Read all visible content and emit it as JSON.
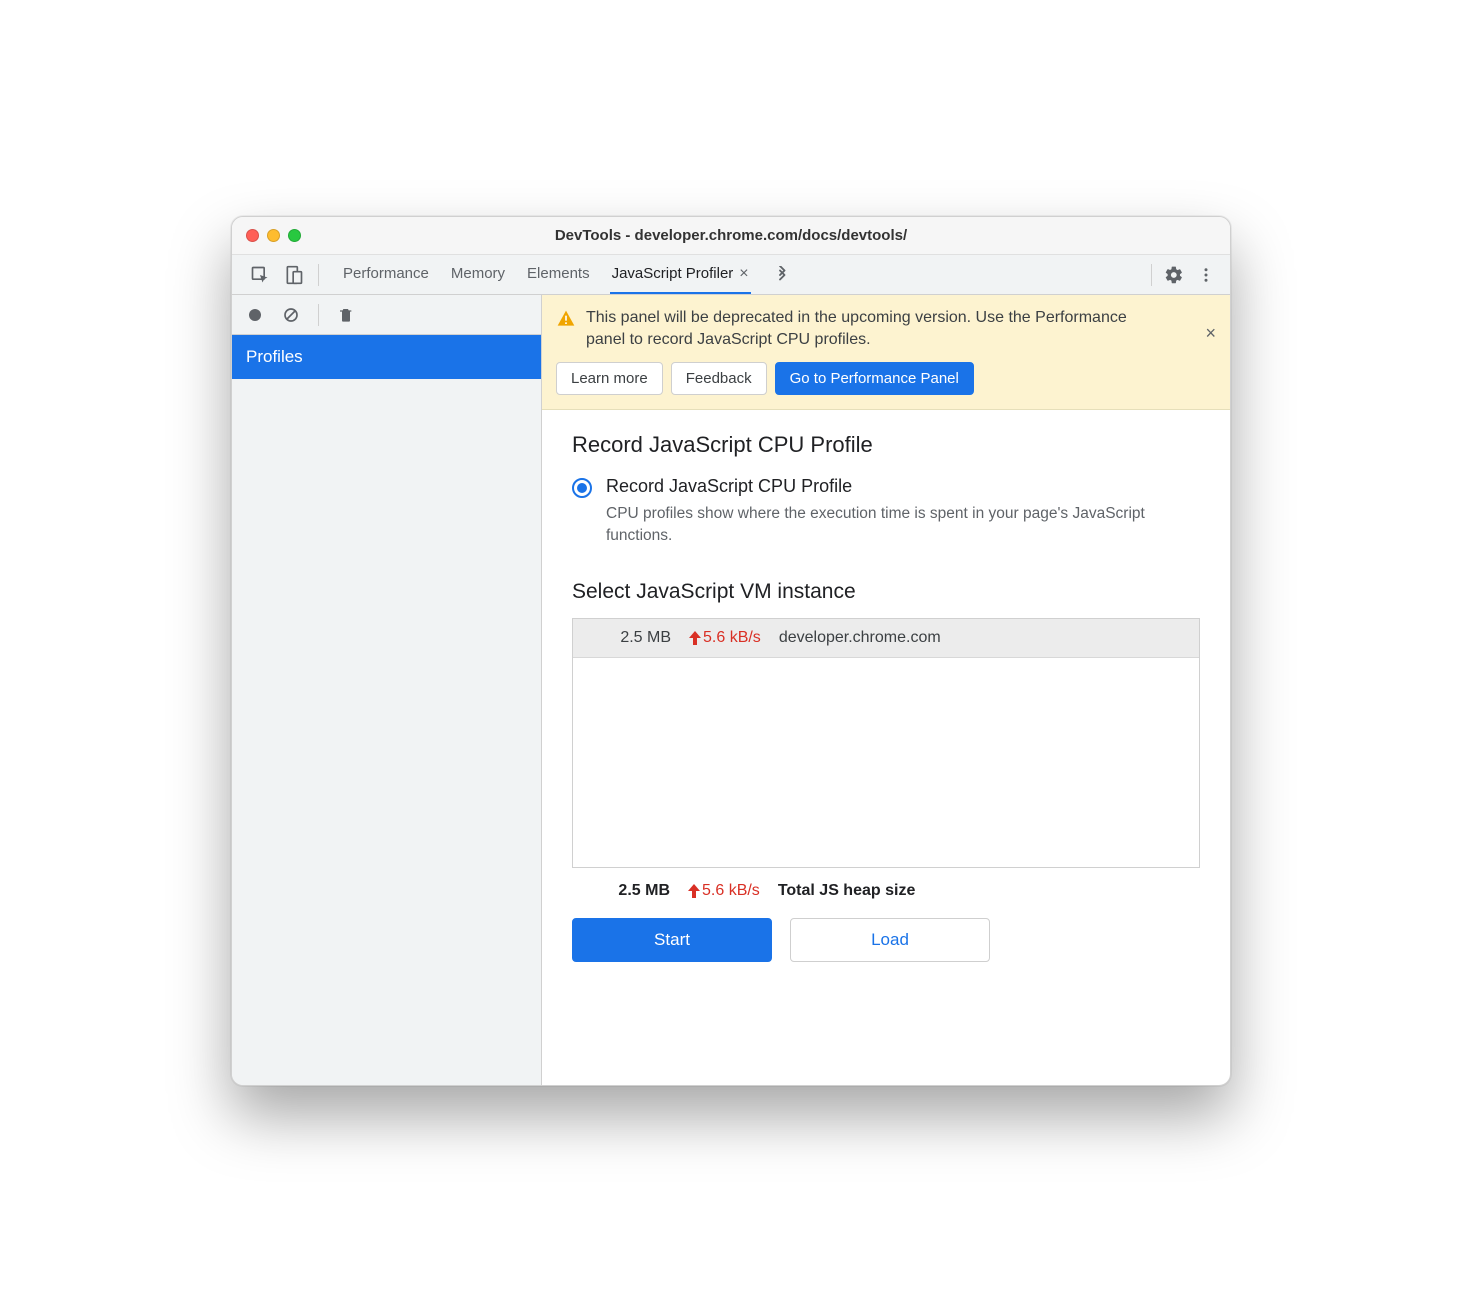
{
  "window": {
    "title": "DevTools - developer.chrome.com/docs/devtools/"
  },
  "tabs": {
    "items": [
      "Performance",
      "Memory",
      "Elements",
      "JavaScript Profiler"
    ],
    "active_index": 3
  },
  "sidebar": {
    "items": [
      "Profiles"
    ]
  },
  "banner": {
    "text": "This panel will be deprecated in the upcoming version. Use the Performance panel to record JavaScript CPU profiles.",
    "learn_more": "Learn more",
    "feedback": "Feedback",
    "goto": "Go to Performance Panel"
  },
  "profile": {
    "heading": "Record JavaScript CPU Profile",
    "radio_label": "Record JavaScript CPU Profile",
    "radio_desc": "CPU profiles show where the execution time is spent in your page's JavaScript functions."
  },
  "vm": {
    "heading": "Select JavaScript VM instance",
    "instances": [
      {
        "size": "2.5 MB",
        "rate": "5.6 kB/s",
        "host": "developer.chrome.com"
      }
    ],
    "total_size": "2.5 MB",
    "total_rate": "5.6 kB/s",
    "total_label": "Total JS heap size"
  },
  "actions": {
    "start": "Start",
    "load": "Load"
  }
}
